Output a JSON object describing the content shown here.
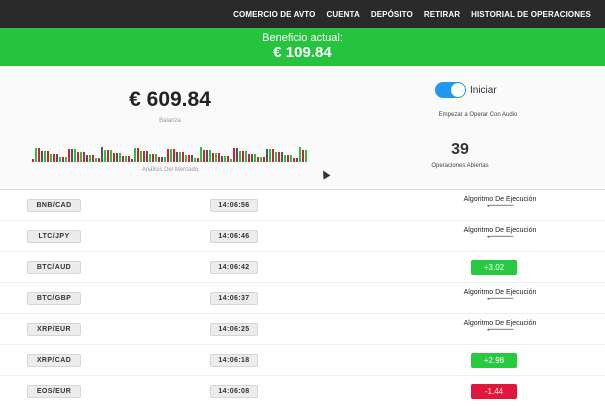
{
  "nav": {
    "items": [
      "COMERCIO DE AVTO",
      "CUENTA",
      "DEPÓSITO",
      "RETIRAR",
      "HISTORIAL DE OPERACIONES"
    ]
  },
  "banner": {
    "label": "Beneficio actual:",
    "value": "€ 109.84"
  },
  "balance": {
    "amount": "€ 609.84",
    "caption": "Balanza"
  },
  "toggle": {
    "label": "Iniciar",
    "caption": "Empezar a Operar Con Audio",
    "on": true
  },
  "market": {
    "caption": "Análisis Del Mercado"
  },
  "open_ops": {
    "count": "39",
    "caption": "Operaciones Abiertas"
  },
  "colors": {
    "green": "#26c33e",
    "red": "#e0173c",
    "blue": "#2196f3"
  },
  "rows": [
    {
      "pair": "BNB/CAD",
      "time": "14:06:56",
      "status": "Algoritmo De Ejecución",
      "arrow": "◂━━━━━━━━"
    },
    {
      "pair": "LTC/JPY",
      "time": "14:06:46",
      "status": "Algoritmo De Ejecución",
      "arrow": "◂━━━━━━━━"
    },
    {
      "pair": "BTC/AUD",
      "time": "14:06:42",
      "result": "+3.02",
      "kind": "pos"
    },
    {
      "pair": "BTC/GBP",
      "time": "14:06:37",
      "status": "Algoritmo De Ejecución",
      "arrow": "◂━━━━━━━━"
    },
    {
      "pair": "XRP/EUR",
      "time": "14:06:25",
      "status": "Algoritmo De Ejecución",
      "arrow": "◂━━━━━━━━"
    },
    {
      "pair": "XRP/CAD",
      "time": "14:06:18",
      "result": "+2.98",
      "kind": "pos"
    },
    {
      "pair": "EOS/EUR",
      "time": "14:06:08",
      "result": "-1.44",
      "kind": "neg"
    }
  ]
}
